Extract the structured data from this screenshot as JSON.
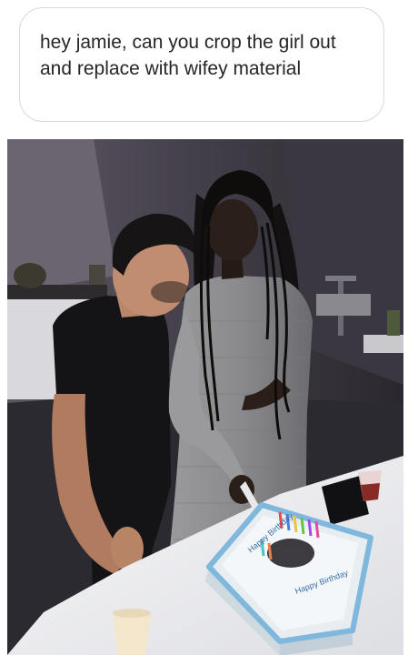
{
  "message": {
    "text": "hey jamie, can you crop the girl out and replace with wifey material"
  },
  "photo": {
    "cake_text_1": "Happy Birthday",
    "cake_text_2": "Happy Birthday"
  },
  "colors": {
    "bubble_border": "#d9d9d9",
    "text": "#262626",
    "dress": "#8a8a8c",
    "shirt": "#141416",
    "cake_icing": "#eef3f6",
    "cake_border": "#7fb8dc"
  }
}
